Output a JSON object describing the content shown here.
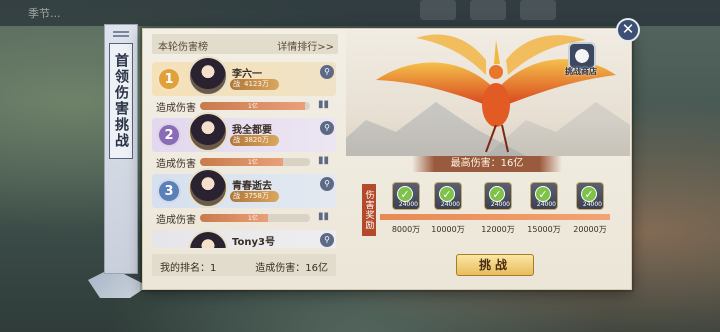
{
  "background": {
    "title": "季节..."
  },
  "banner": {
    "title": "首领伤害挑战"
  },
  "list": {
    "title": "本轮伤害榜",
    "detail_link": "详情排行>>",
    "damage_label": "造成伤害",
    "search_label": "查看",
    "entries": [
      {
        "rank": "1",
        "name": "李六一",
        "power": "4123万",
        "damage_text": "1亿",
        "damage_fraction": 0.95,
        "rank_color": "#e0a13a"
      },
      {
        "rank": "2",
        "name": "我全都要",
        "power": "3820万",
        "damage_text": "1亿",
        "damage_fraction": 0.75,
        "rank_color": "#8a6bb5"
      },
      {
        "rank": "3",
        "name": "青春逝去",
        "power": "3758万",
        "damage_text": "1亿",
        "damage_fraction": 0.62,
        "rank_color": "#5b7fb8"
      },
      {
        "rank": "",
        "name": "Tony3号",
        "power": "",
        "damage_text": "",
        "damage_fraction": 0,
        "rank_color": "#a3a9b4"
      }
    ],
    "my_rank_label": "我的排名：1",
    "my_damage_label": "造成伤害：16亿"
  },
  "boss": {
    "shop_label": "挑战商店",
    "max_damage": "最高伤害：16亿"
  },
  "rewards": {
    "label": "伤害奖励",
    "progress_fraction": 1.0,
    "items": [
      {
        "amount": "24000",
        "threshold": "8000万"
      },
      {
        "amount": "24000",
        "threshold": "10000万"
      },
      {
        "amount": "24000",
        "threshold": "12000万"
      },
      {
        "amount": "24000",
        "threshold": "15000万"
      },
      {
        "amount": "24000",
        "threshold": "20000万"
      }
    ]
  },
  "buttons": {
    "challenge": "挑战",
    "close": "✕"
  },
  "colors": {
    "accent": "#b44a2c",
    "button_gold": "#e8bd5c",
    "phoenix": "#e06a2a"
  }
}
